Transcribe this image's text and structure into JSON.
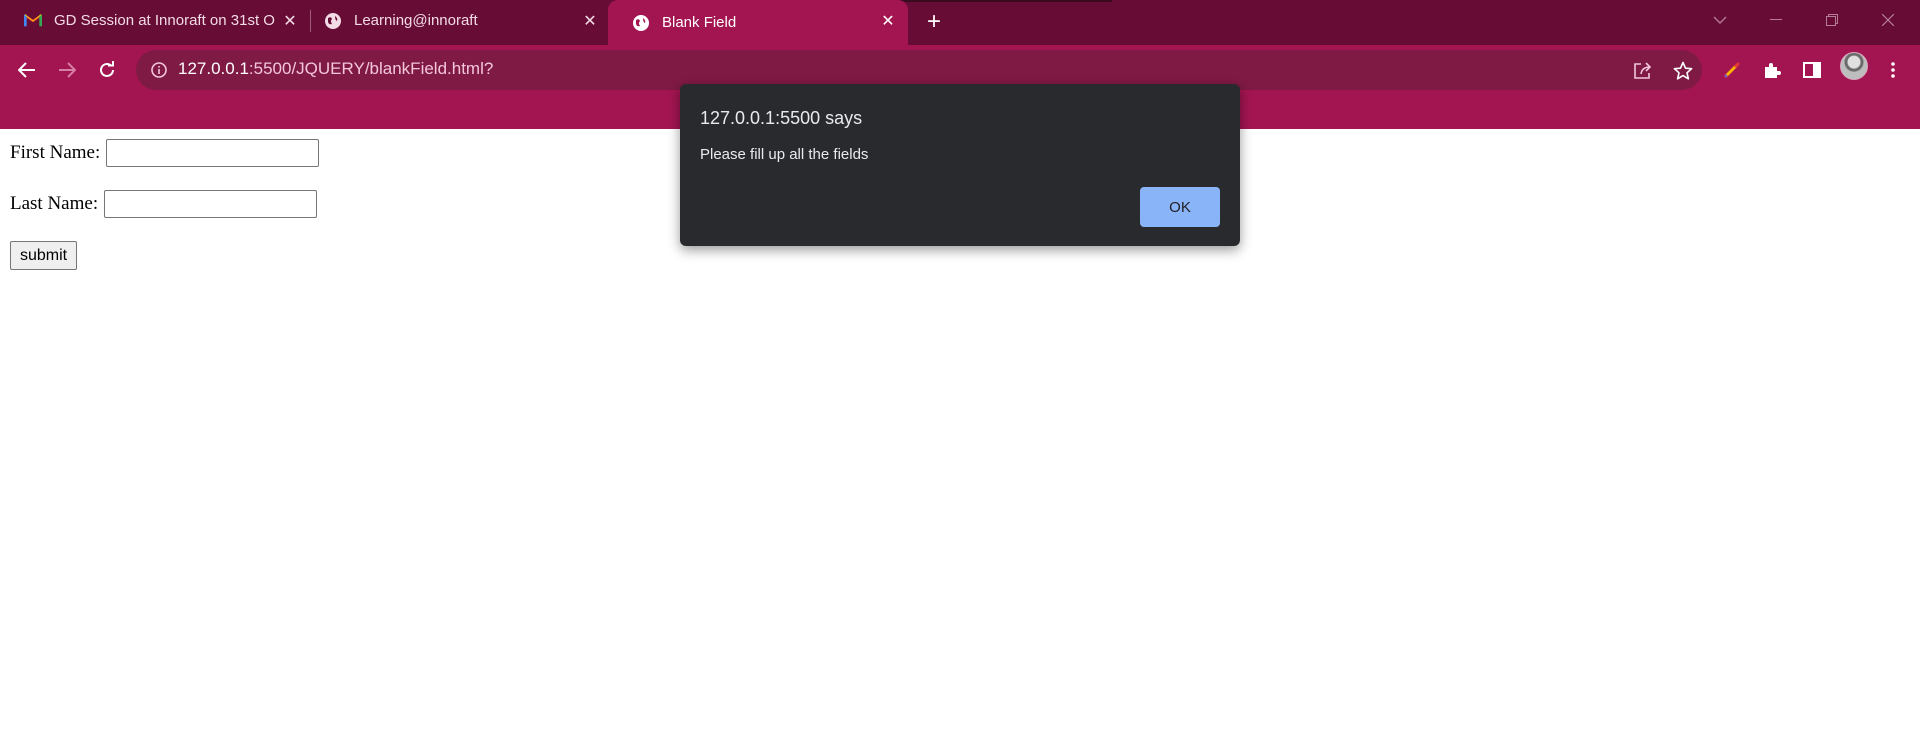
{
  "browser": {
    "tabs": [
      {
        "title": "GD Session at Innoraft on 31st O",
        "favicon": "gmail-icon",
        "active": false
      },
      {
        "title": "Learning@innoraft",
        "favicon": "globe-icon",
        "active": false
      },
      {
        "title": "Blank Field",
        "favicon": "globe-icon",
        "active": true
      }
    ],
    "new_tab_label": "+",
    "url_host": "127.0.0.1",
    "url_rest": ":5500/JQUERY/blankField.html?",
    "colors": {
      "frame": "#660c35",
      "toolbar": "#a31551",
      "omnibox": "#7f1a45"
    }
  },
  "form": {
    "first_name_label": "First Name:",
    "last_name_label": "Last Name:",
    "first_name_value": "",
    "last_name_value": "",
    "submit_label": "submit"
  },
  "alert": {
    "title": "127.0.0.1:5500 says",
    "message": "Please fill up all the fields",
    "ok_label": "OK",
    "ok_color": "#8ab4f8"
  }
}
